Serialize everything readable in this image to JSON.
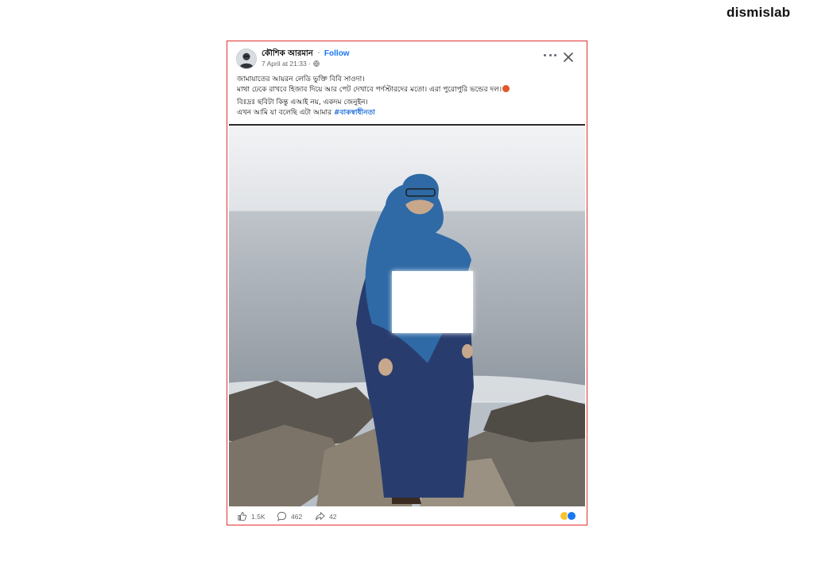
{
  "brand": {
    "logo_text": "dismislab"
  },
  "post": {
    "author": "কৌশিক আরমান",
    "separator": "·",
    "follow_label": "Follow",
    "timestamp": "7 April at 21:33 ·",
    "caption_lines": [
      "জামায়াতের আয়রন লেডি ভুক্তি বিবি সাওদা।",
      "মাথা ঢেকে রাখবে হিজাব দিয়ে আর পেট দেখাবে পর্ণস্টারদের মতো। এরা পুরোপুরি ভন্ডের দল।",
      "বিঃদ্রঃ ছবিটা কিন্তু এআই নয়, একদম জেনুইন।",
      "এখন আমি যা বলেছি এটা আমার"
    ],
    "hashtag": "#বাকস্বাধীনতা",
    "likes": "1.5K",
    "comments": "462",
    "shares": "42",
    "icons": {
      "more": "more-options-icon",
      "close": "close-icon",
      "privacy": "globe-icon",
      "like": "like-icon",
      "comment": "comment-icon",
      "share": "share-icon"
    },
    "colors": {
      "border": "#e0312f",
      "link": "#1877f2",
      "hashtag": "#216fdb"
    }
  }
}
